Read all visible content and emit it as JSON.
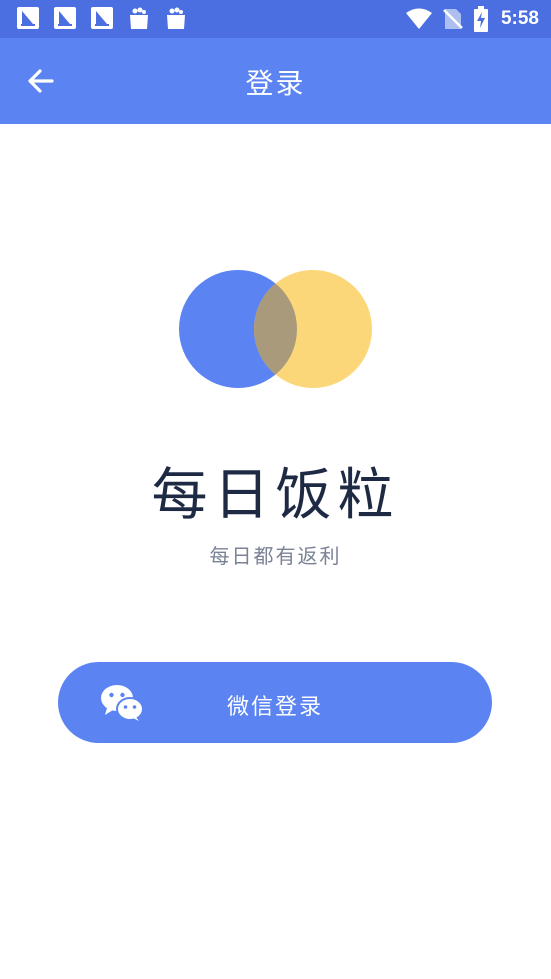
{
  "status_bar": {
    "time": "5:58",
    "notification_icons": [
      "sailboat-app-icon",
      "sailboat-app-icon",
      "sailboat-app-icon",
      "shopping-bag-icon",
      "shopping-bag-icon"
    ],
    "system_icons": [
      "wifi-icon",
      "no-sim-icon",
      "battery-charging-icon"
    ]
  },
  "toolbar": {
    "title": "登录",
    "back_icon": "arrow-left-icon"
  },
  "logo": {
    "left_circle_color": "#5b84f2",
    "right_circle_color": "#fbd779",
    "overlap_color": "#a89a7a"
  },
  "app": {
    "name": "每日饭粒",
    "slogan": "每日都有返利"
  },
  "login": {
    "wechat_label": "微信登录",
    "wechat_icon": "wechat-icon"
  },
  "colors": {
    "status_bar": "#4b6fe1",
    "primary": "#5b84f2",
    "title_text": "#1e2a44",
    "subtitle_text": "#7a8295"
  }
}
